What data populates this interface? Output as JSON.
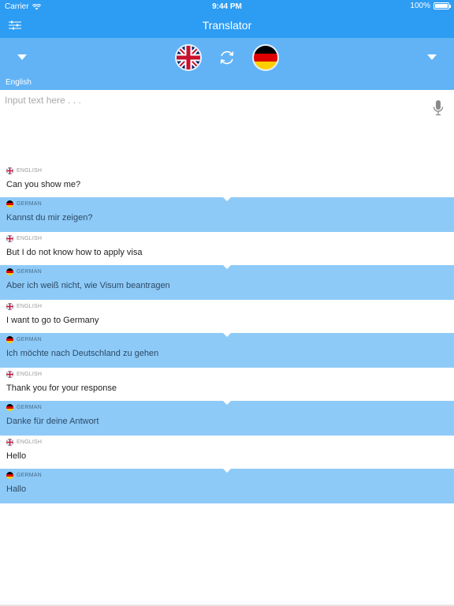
{
  "status_bar": {
    "carrier": "Carrier",
    "time": "9:44 PM",
    "battery": "100%"
  },
  "nav": {
    "title": "Translator",
    "menu_icon": "sliders-icon"
  },
  "language_bar": {
    "source_language": "English",
    "source_flag": "uk-flag-icon",
    "target_flag": "germany-flag-icon",
    "swap_icon": "swap-arrows-icon"
  },
  "input": {
    "placeholder": "Input text here . . .",
    "value": "",
    "mic_icon": "microphone-icon"
  },
  "colors": {
    "primary": "#2d9cf3",
    "language_bar": "#61b3f6",
    "translation_row": "#8ecaf7"
  },
  "conversation": [
    {
      "source_tag": "ENGLISH",
      "source_text": "Can you show me?",
      "target_tag": "GERMAN",
      "target_text": "Kannst du mir zeigen?"
    },
    {
      "source_tag": "ENGLISH",
      "source_text": "But I do not know how to apply visa",
      "target_tag": "GERMAN",
      "target_text": "Aber ich weiß nicht, wie Visum beantragen"
    },
    {
      "source_tag": "ENGLISH",
      "source_text": "I want to go to Germany",
      "target_tag": "GERMAN",
      "target_text": "Ich möchte nach Deutschland zu gehen"
    },
    {
      "source_tag": "ENGLISH",
      "source_text": "Thank you for your response",
      "target_tag": "GERMAN",
      "target_text": "Danke für deine Antwort"
    },
    {
      "source_tag": "ENGLISH",
      "source_text": "Hello",
      "target_tag": "GERMAN",
      "target_text": "Hallo"
    }
  ]
}
